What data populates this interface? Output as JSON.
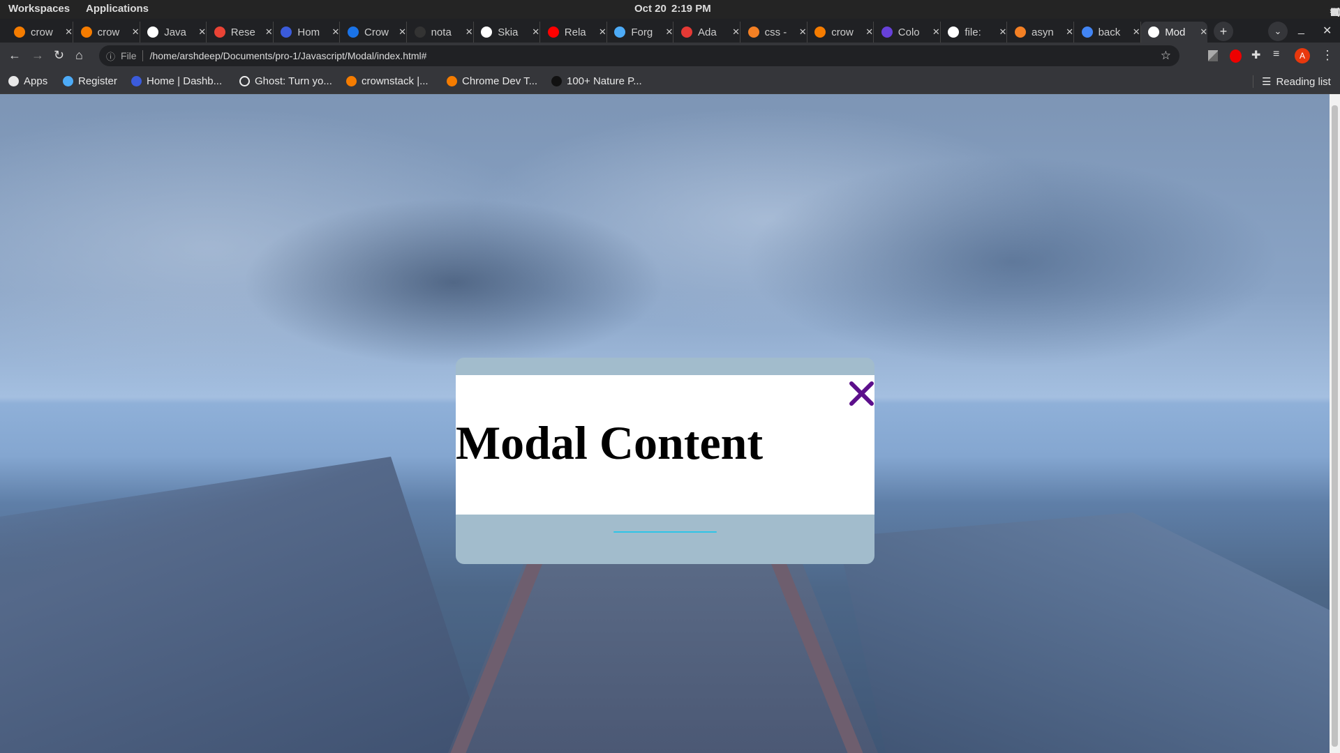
{
  "system": {
    "workspaces": "Workspaces",
    "applications": "Applications",
    "date": "Oct 20",
    "time": "2:19 PM"
  },
  "tabs": [
    {
      "label": "crow",
      "icon": "crownstack-icon",
      "color": "#f57c00"
    },
    {
      "label": "crow",
      "icon": "crownstack-icon",
      "color": "#f57c00"
    },
    {
      "label": "Java",
      "icon": "bookmark-app-icon",
      "color": "#ffffff"
    },
    {
      "label": "Rese",
      "icon": "gmail-icon",
      "color": "#ea4335"
    },
    {
      "label": "Hom",
      "icon": "k-icon",
      "color": "#3b5bdb"
    },
    {
      "label": "Crow",
      "icon": "calendar-icon",
      "color": "#1a73e8"
    },
    {
      "label": "nota",
      "icon": "github-icon",
      "color": "#333333"
    },
    {
      "label": "Skia",
      "icon": "globe-icon",
      "color": "#ffffff"
    },
    {
      "label": "Rela",
      "icon": "youtube-icon",
      "color": "#ff0000"
    },
    {
      "label": "Forg",
      "icon": "k-icon",
      "color": "#4dabf7"
    },
    {
      "label": "Ada",
      "icon": "asterisk-icon",
      "color": "#e53935"
    },
    {
      "label": "css -",
      "icon": "stackoverflow-icon",
      "color": "#f48024"
    },
    {
      "label": "crow",
      "icon": "crownstack-icon",
      "color": "#f57c00"
    },
    {
      "label": "Colo",
      "icon": "c-icon",
      "color": "#6741d9"
    },
    {
      "label": "file:",
      "icon": "globe-icon",
      "color": "#ffffff"
    },
    {
      "label": "asyn",
      "icon": "stackoverflow-icon",
      "color": "#f48024"
    },
    {
      "label": "back",
      "icon": "google-icon",
      "color": "#4285f4"
    },
    {
      "label": "Mod",
      "icon": "globe-icon",
      "color": "#ffffff",
      "active": true
    }
  ],
  "toolbar": {
    "file_label": "File",
    "url": "/home/arshdeep/Documents/pro-1/Javascript/Modal/index.html#",
    "profile_initial": "A"
  },
  "bookmarks": [
    {
      "label": "Apps",
      "icon": "apps-grid-icon",
      "color": "#e8e8e8"
    },
    {
      "label": "Register",
      "icon": "k-icon",
      "color": "#4dabf7"
    },
    {
      "label": "Home | Dashb...",
      "icon": "k-icon",
      "color": "#3b5bdb"
    },
    {
      "label": "Ghost: Turn yo...",
      "icon": "ghost-icon",
      "color": "#35363a"
    },
    {
      "label": "crownstack |...",
      "icon": "crownstack-icon",
      "color": "#f57c00"
    },
    {
      "label": "Chrome Dev T...",
      "icon": "crownstack-icon",
      "color": "#f57c00"
    },
    {
      "label": "100+ Nature P...",
      "icon": "unsplash-icon",
      "color": "#111111"
    }
  ],
  "reading_list": "Reading list",
  "modal": {
    "title": "Modal Content",
    "close_color": "#5c0f8b"
  }
}
